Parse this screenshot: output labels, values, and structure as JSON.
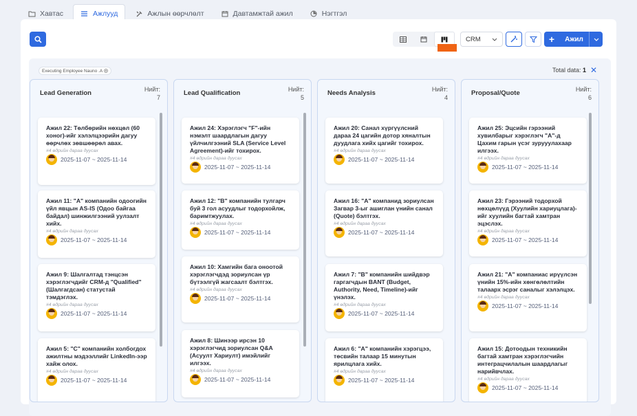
{
  "tabs": [
    {
      "label": "Хавтас",
      "icon": "folder-icon"
    },
    {
      "label": "Ажлууд",
      "icon": "list-icon"
    },
    {
      "label": "Ажлын өөрчлөлт",
      "icon": "tools-icon"
    },
    {
      "label": "Давтамжтай ажил",
      "icon": "calendar-icon"
    },
    {
      "label": "Нэгтгэл",
      "icon": "pie-icon"
    }
  ],
  "toolbar": {
    "crm_select": "CRM",
    "add_label": "Ажил"
  },
  "board": {
    "filter_chip": "Executing Employee Nauno .A",
    "total_label": "Total data:",
    "total_value": "1"
  },
  "columns": [
    {
      "title": "Lead Generation",
      "count_label": "Нийт:",
      "count": "7",
      "cards": [
        {
          "title": "Ажил 22: Төлбөрийн нөхцөл (60 хоног)-ийг хэлэлцээрийн дагуу өөрчлөх зөвшөөрөл авах.",
          "sub": "#4 өдрийн дараа дуусах",
          "dates": "2025-11-07 ~ 2025-11-14"
        },
        {
          "title": "Ажил 11: \"А\" компанийн одоогийн үйл явцын AS-IS (Одоо байгаа байдал) шинжилгээний уулзалт хийх.",
          "sub": "#4 өдрийн дараа дуусах",
          "dates": "2025-11-07 ~ 2025-11-14"
        },
        {
          "title": "Ажил 9: Шалгалтад тэнцсэн хэрэглэгчдийг CRM-д \"Qualified\" (Шалгагдсан) статустай тэмдэглэх.",
          "sub": "#4 өдрийн дараа дуусах",
          "dates": "2025-11-07 ~ 2025-11-14"
        },
        {
          "title": "Ажил 5: \"С\" компанийн холбогдох ажилтны мэдээллийг LinkedIn-ээр хайж олох.",
          "sub": "#4 өдрийн дараа дуусах",
          "dates": "2025-11-07 ~ 2025-11-14"
        }
      ]
    },
    {
      "title": "Lead Qualification",
      "count_label": "Нийт:",
      "count": "5",
      "cards": [
        {
          "title": "Ажил 24: Хэрэглэгч \"F\"-ийн нэмэлт шаардлагын дагуу үйлчилгээний SLA (Service Level Agreement)-ийг тохирох.",
          "sub": "#4 өдрийн дараа дуусах",
          "dates": "2025-11-07 ~ 2025-11-14"
        },
        {
          "title": "Ажил 12: \"В\" компанийн тулгарч буй 3 гол асуудлыг тодорхойлж, баримтжуулах.",
          "sub": "#4 өдрийн дараа дуусах",
          "dates": "2025-11-07 ~ 2025-11-14"
        },
        {
          "title": "Ажил 10: Хамгийн бага оноотой хэрэглэгчдэд зориулсан үр бүтээлгүй жагсаалт бэлтгэх.",
          "sub": "#4 өдрийн дараа дуусах",
          "dates": "2025-11-07 ~ 2025-11-14"
        },
        {
          "title": "Ажил 8: Шинээр ирсэн 10 хэрэглэгчид зориулсан Q&A (Асуулт Хариулт) имэйлийг илгээх.",
          "sub": "#4 өдрийн дараа дуусах",
          "dates": "2025-11-07 ~ 2025-11-14"
        }
      ]
    },
    {
      "title": "Needs Analysis",
      "count_label": "Нийт:",
      "count": "4",
      "cards": [
        {
          "title": "Ажил 20: Санал хүргүүлсний дараа 24 цагийн дотор хяналтын дуудлага хийх цагийг тохирох.",
          "sub": "#4 өдрийн дараа дуусах",
          "dates": "2025-11-07 ~ 2025-11-14"
        },
        {
          "title": "Ажил 16: \"А\" компанид зориулсан Загвар 3-ыг ашиглан үнийн санал (Quote) бэлтгэх.",
          "sub": "#4 өдрийн дараа дуусах",
          "dates": "2025-11-07 ~ 2025-11-14"
        },
        {
          "title": "Ажил 7: \"В\" компанийн шийдвэр гаргагчдын BANT (Budget, Authority, Need, Timeline)-ийг үнэлэх.",
          "sub": "#4 өдрийн дараа дуусах",
          "dates": "2025-11-07 ~ 2025-11-14"
        },
        {
          "title": "Ажил 6: \"А\" компанийн хэрэгцээ, төсвийн талаар 15 минутын ярилцлага хийх.",
          "sub": "#4 өдрийн дараа дуусах",
          "dates": "2025-11-07 ~ 2025-11-14"
        }
      ]
    },
    {
      "title": "Proposal/Quote",
      "count_label": "Нийт:",
      "count": "6",
      "cards": [
        {
          "title": "Ажил 25: Эцсийн гэрээний хувилбарыг хэрэглэгч \"А\"-д Цахим гарын үсэг зурууулахаар илгээх.",
          "sub": "#4 өдрийн дараа дуусах",
          "dates": "2025-11-07 ~ 2025-11-14"
        },
        {
          "title": "Ажил 23: Гэрээний тодорхой нөхцөлүүд (Хуулийн хариуцлага)-ийг хуулийн багтай хамтран эцэслэх.",
          "sub": "#4 өдрийн дараа дуусах",
          "dates": "2025-11-07 ~ 2025-11-14"
        },
        {
          "title": "Ажил 21: \"А\" компаниас ирүүлсэн үнийн 15%-ийн хөнгөлөлтийн талаарх эсрэг саналыг хэлэлцэх.",
          "sub": "#4 өдрийн дараа дуусах",
          "dates": "2025-11-07 ~ 2025-11-14"
        },
        {
          "title": "Ажил 15: Дотоодын техникийн багтай хамтран хэрэглэгчийн интеграцчилалын шаардлагыг нарийвчлах.",
          "sub": "#4 өдрийн дараа дуусах",
          "dates": "2025-11-07 ~ 2025-11-14"
        }
      ]
    }
  ]
}
